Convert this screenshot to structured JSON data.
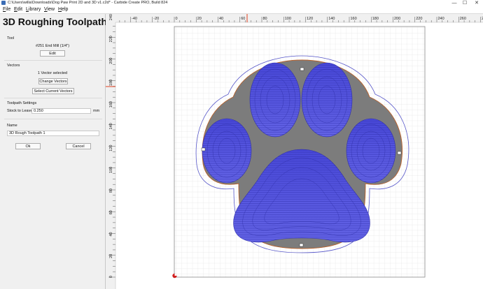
{
  "window": {
    "title": "C:\\Users\\willa\\Downloads\\Dog Paw Print 2D and 3D v1.c2d* - Carbide Create PRO, Build 824",
    "minimize": "—",
    "maximize": "☐",
    "close": "✕"
  },
  "menu": [
    "File",
    "Edit",
    "Library",
    "View",
    "Help"
  ],
  "panel": {
    "title": "3D Roughing Toolpath",
    "tool_header": "Tool",
    "tool_name": "#251 End Mill (1/4\")",
    "tool_edit": "Edit",
    "vectors_header": "Vectors",
    "vectors_status": "1 Vector selected",
    "change_vectors": "Change Vectors",
    "select_current": "Select Current Vectors",
    "settings_header": "Toolpath Settings",
    "stock_label": "Stock to Leave",
    "stock_value": "0.250",
    "stock_unit": "mm",
    "name_header": "Name",
    "name_value": "3D Rough Toolpath 1",
    "ok": "Ok",
    "cancel": "Cancel"
  },
  "canvas": {
    "ruler_x": [
      "-40",
      "-20",
      "0",
      "20",
      "40",
      "60",
      "80",
      "100",
      "120",
      "140",
      "160",
      "180",
      "200",
      "220",
      "240",
      "260",
      "280",
      "300"
    ],
    "ruler_y": [
      "0",
      "20",
      "40",
      "60",
      "80",
      "100",
      "120",
      "140",
      "160",
      "180",
      "200",
      "220",
      "240"
    ],
    "colors": {
      "stock": "#7c7c7c",
      "pocket": "#5f5fe2",
      "outline": "#4040b0",
      "vector": "#b8602a",
      "grid": "#dcdcdc",
      "ruler": "#f0f0f0"
    }
  }
}
